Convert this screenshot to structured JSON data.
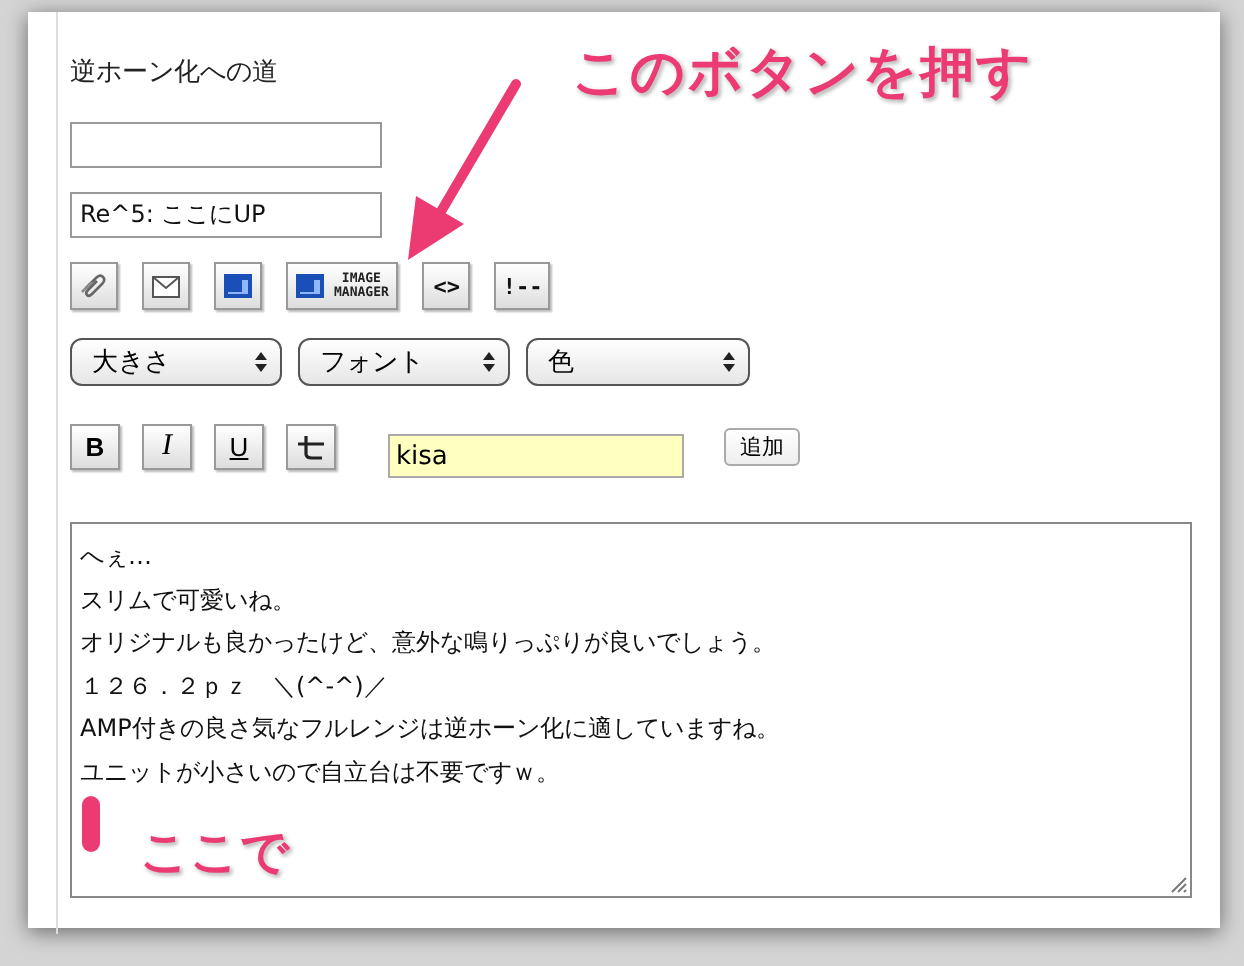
{
  "title": "逆ホーン化への道",
  "fields": [
    {
      "kind": "blank"
    },
    {
      "kind": "filled",
      "value": "Re^5: ここにUP"
    }
  ],
  "toolbar": [
    {
      "kind": "clip"
    },
    {
      "kind": "mail"
    },
    {
      "kind": "image"
    },
    {
      "kind": "manager",
      "label": [
        "IMAGE",
        "MANAGER"
      ]
    },
    {
      "kind": "text",
      "label": "<>"
    },
    {
      "kind": "text",
      "label": "!--"
    }
  ],
  "selects": [
    {
      "label": "大きさ"
    },
    {
      "label": "フォント"
    },
    {
      "label": "色"
    }
  ],
  "format_buttons": [
    {
      "kind": "bold",
      "label": "B"
    },
    {
      "kind": "italic",
      "label": "I"
    },
    {
      "kind": "underline",
      "label": "U"
    },
    {
      "kind": "strike"
    }
  ],
  "name_field": {
    "value": "kisa"
  },
  "add_button": "追加",
  "message_lines": [
    "へぇ…",
    "スリムで可愛いね。",
    "オリジナルも良かったけど、意外な鳴りっぷりが良いでしょう。",
    "１２６．２ｐｚ　＼(^-^)／",
    "AMP付きの良さ気なフルレンジは逆ホーン化に適していますね。",
    "ユニットが小さいので自立台は不要ですｗ。"
  ],
  "annotations": [
    {
      "kind": "callout",
      "text": "このボタンを押す"
    },
    {
      "kind": "cursor",
      "text": "ここで"
    }
  ]
}
